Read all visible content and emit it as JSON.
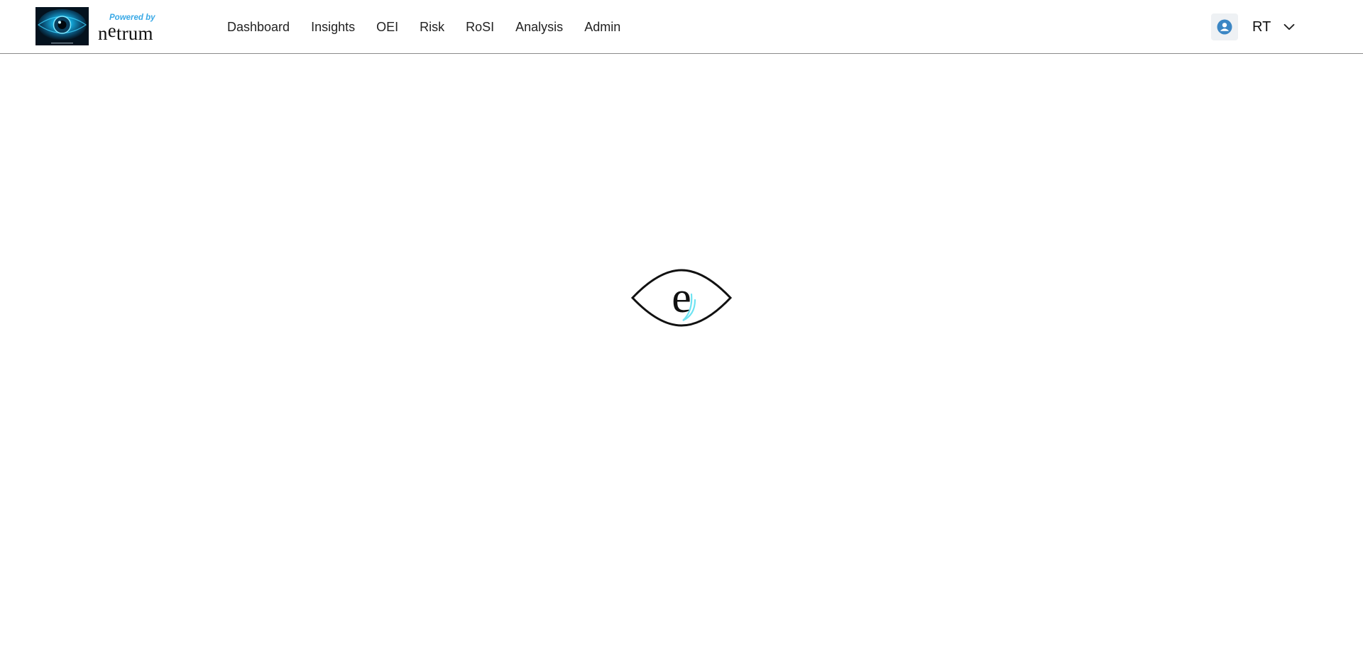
{
  "header": {
    "powered_by": "Powered by",
    "brand_before": "n",
    "brand_e": "e",
    "brand_after": "trum"
  },
  "nav": {
    "items": [
      {
        "label": "Dashboard"
      },
      {
        "label": "Insights"
      },
      {
        "label": "OEI"
      },
      {
        "label": "Risk"
      },
      {
        "label": "RoSI"
      },
      {
        "label": "Analysis"
      },
      {
        "label": "Admin"
      }
    ]
  },
  "user": {
    "initials": "RT",
    "avatar_icon": "user-circle-icon",
    "menu_icon": "chevron-down-icon"
  },
  "loader": {
    "icon": "eye-e-logo-icon",
    "letter": "e"
  },
  "colors": {
    "accent": "#3aa9e6",
    "avatar_bg": "#eef1f4",
    "avatar_icon": "#3b86c4",
    "divider": "#8a8a8a",
    "logo_bg": "#04121e",
    "logo_glow": "#16c2f0"
  }
}
